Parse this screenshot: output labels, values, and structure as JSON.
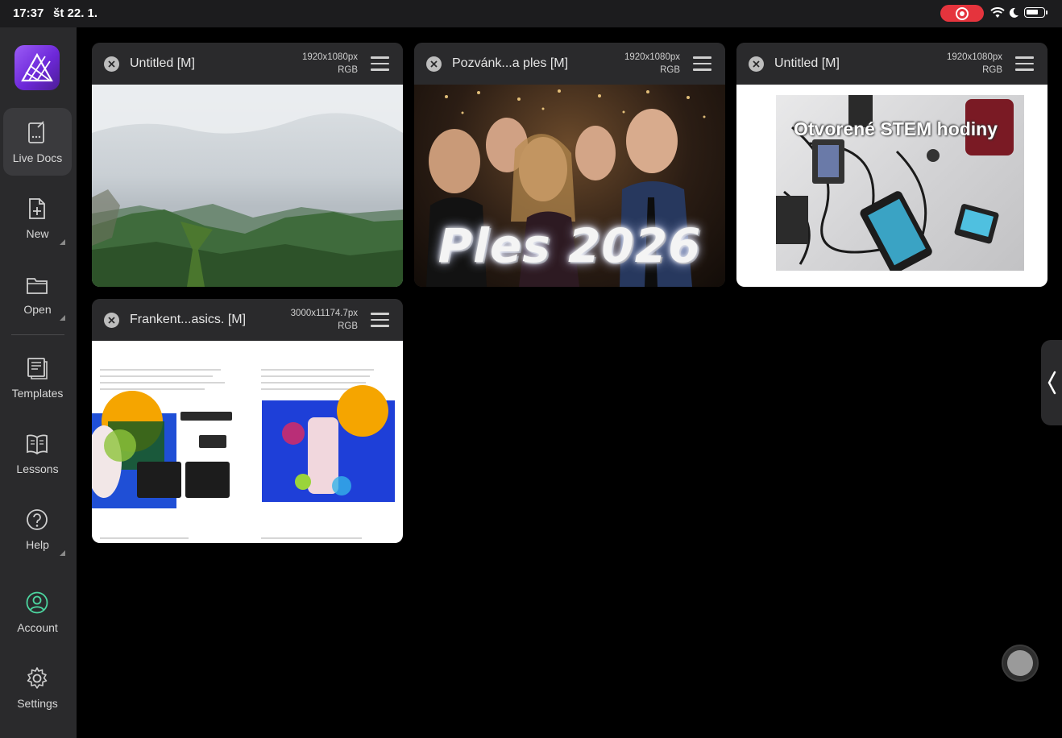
{
  "status_bar": {
    "time": "17:37",
    "date": "št 22. 1."
  },
  "sidebar": {
    "items": [
      {
        "label": "Live Docs",
        "icon": "live-docs-icon",
        "active": true
      },
      {
        "label": "New",
        "icon": "new-document-icon"
      },
      {
        "label": "Open",
        "icon": "folder-icon"
      },
      {
        "label": "Templates",
        "icon": "templates-icon"
      },
      {
        "label": "Lessons",
        "icon": "book-icon"
      },
      {
        "label": "Help",
        "icon": "help-icon"
      },
      {
        "label": "Account",
        "icon": "account-icon",
        "accent": "#4cd6a0"
      },
      {
        "label": "Settings",
        "icon": "gear-icon"
      }
    ]
  },
  "documents": [
    {
      "title": "Untitled [M]",
      "dims": "1920x1080px",
      "color_mode": "RGB"
    },
    {
      "title": "Pozvánk...a ples [M]",
      "dims": "1920x1080px",
      "color_mode": "RGB",
      "thumb_text": "Ples 2026"
    },
    {
      "title": "Untitled [M]",
      "dims": "1920x1080px",
      "color_mode": "RGB",
      "thumb_text": "Otvorené STEM hodiny"
    },
    {
      "title": "Frankent...asics. [M]",
      "dims": "3000x11174.7px",
      "color_mode": "RGB"
    }
  ],
  "colors": {
    "accent": "#7c3aed",
    "record": "#e5343d",
    "account": "#4cd6a0"
  }
}
